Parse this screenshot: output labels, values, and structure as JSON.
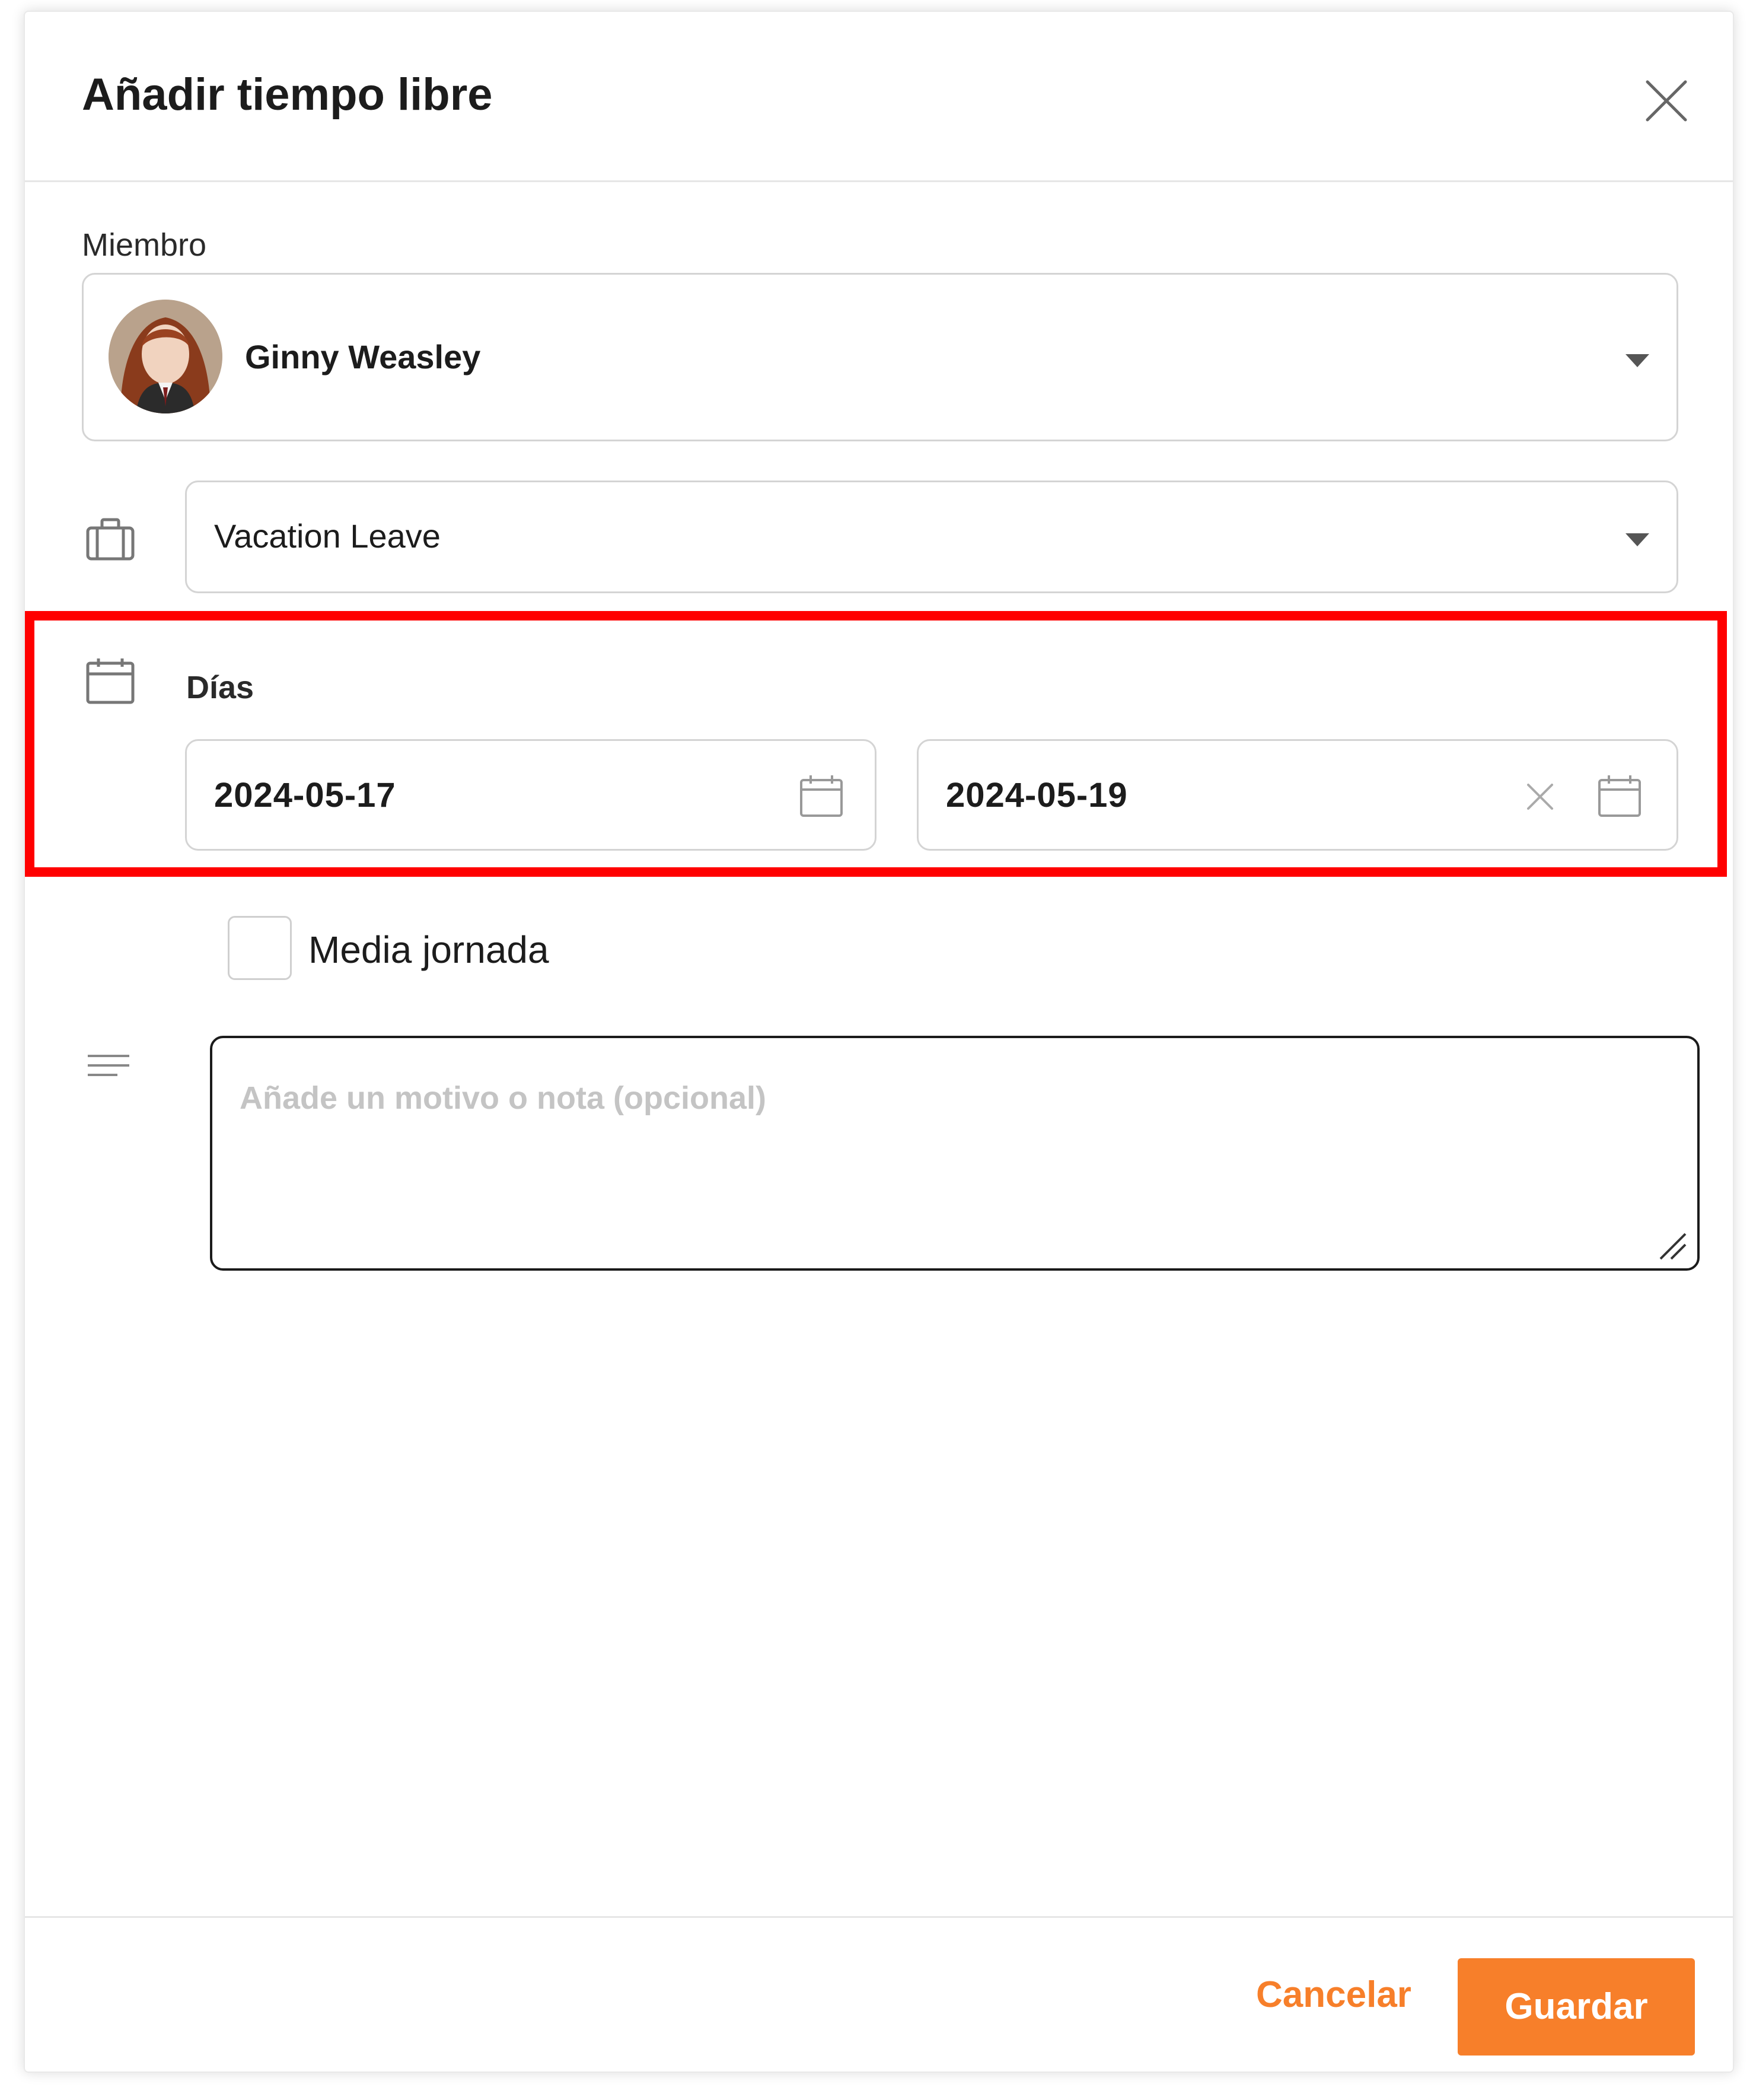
{
  "dialog": {
    "title": "Añadir tiempo libre",
    "close_icon": "close-icon"
  },
  "member": {
    "label": "Miembro",
    "selected_name": "Ginny Weasley",
    "avatar_icon": "avatar"
  },
  "leave_type": {
    "icon": "briefcase-icon",
    "selected": "Vacation Leave"
  },
  "days": {
    "icon": "calendar-icon",
    "label": "Días",
    "start_date": "2024-05-17",
    "end_date": "2024-05-19"
  },
  "half_day": {
    "label": "Media jornada",
    "checked": false
  },
  "note": {
    "icon": "text-lines-icon",
    "placeholder": "Añade un motivo o nota (opcional)"
  },
  "footer": {
    "cancel_label": "Cancelar",
    "save_label": "Guardar"
  },
  "colors": {
    "accent": "#f77f2a",
    "highlight": "#ff0000"
  }
}
